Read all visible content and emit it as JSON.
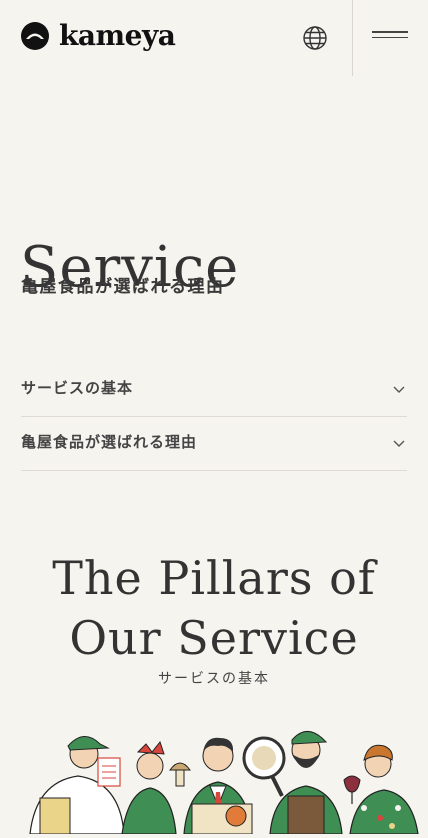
{
  "header": {
    "logo_text": "kameya",
    "language_icon": "globe-icon",
    "menu_icon": "hamburger-icon"
  },
  "hero": {
    "title": "Service",
    "subtitle": "亀屋食品が選ばれる理由"
  },
  "accordion": [
    {
      "label": "サービスの基本",
      "icon": "chevron-down-icon"
    },
    {
      "label": "亀屋食品が選ばれる理由",
      "icon": "chevron-down-icon"
    }
  ],
  "pillars": {
    "title_line1": "The Pillars of",
    "title_line2": "Our Service",
    "subtitle": "サービスの基本"
  },
  "colors": {
    "background": "#f6f4ef",
    "text": "#333333",
    "divider": "#dedbd4",
    "illustration_green": "#3f8f55",
    "illustration_red": "#d9463b"
  }
}
